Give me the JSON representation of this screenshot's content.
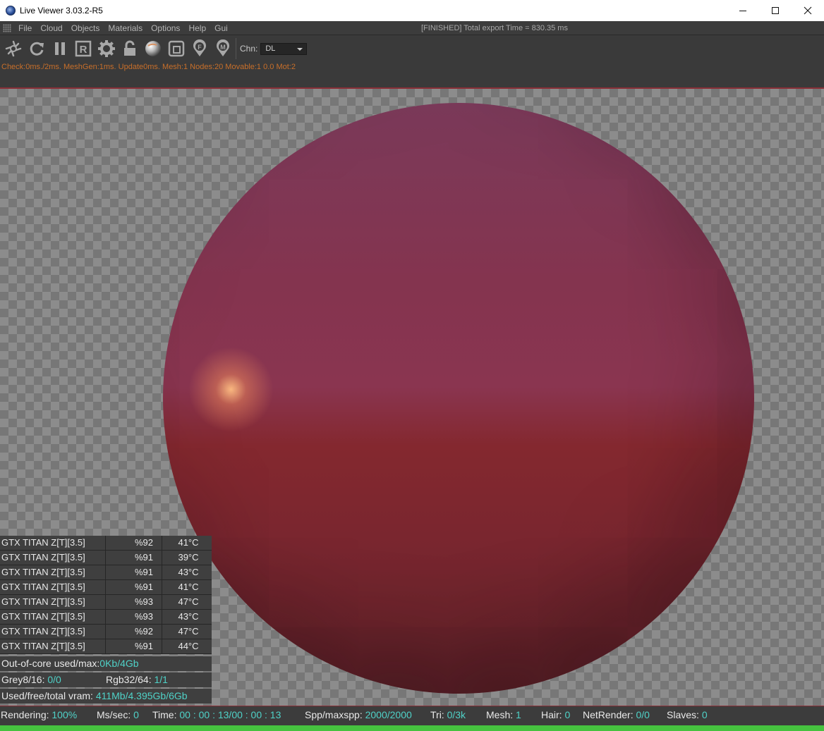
{
  "window": {
    "title": "Live Viewer 3.03.2-R5",
    "controls": {
      "minimize": "minimize-icon",
      "maximize": "maximize-icon",
      "close": "close-icon"
    }
  },
  "menu": {
    "items": [
      "File",
      "Cloud",
      "Objects",
      "Materials",
      "Options",
      "Help",
      "Gui"
    ],
    "export_status": "[FINISHED] Total export Time = 830.35 ms"
  },
  "toolbar": {
    "icons": [
      "send-scene-icon",
      "refresh-icon",
      "pause-icon",
      "render-region-icon",
      "settings-gear-icon",
      "unlock-icon",
      "material-preview-icon",
      "region-icon",
      "focus-pick-icon",
      "material-pick-icon"
    ],
    "channel_label": "Chn:",
    "channel_value": "DL"
  },
  "info_line": "Check:0ms./2ms. MeshGen:1ms. Update0ms. Mesh:1 Nodes:20 Movable:1  0.0 Mot:2",
  "gpus": [
    {
      "name": "GTX TITAN Z[T][3.5]",
      "load": "%92",
      "temp": "41°C"
    },
    {
      "name": "GTX TITAN Z[T][3.5]",
      "load": "%91",
      "temp": "39°C"
    },
    {
      "name": "GTX TITAN Z[T][3.5]",
      "load": "%91",
      "temp": "43°C"
    },
    {
      "name": "GTX TITAN Z[T][3.5]",
      "load": "%91",
      "temp": "41°C"
    },
    {
      "name": "GTX TITAN Z[T][3.5]",
      "load": "%93",
      "temp": "47°C"
    },
    {
      "name": "GTX TITAN Z[T][3.5]",
      "load": "%93",
      "temp": "43°C"
    },
    {
      "name": "GTX TITAN Z[T][3.5]",
      "load": "%92",
      "temp": "47°C"
    },
    {
      "name": "GTX TITAN Z[T][3.5]",
      "load": "%91",
      "temp": "44°C"
    }
  ],
  "memory": {
    "ooc_label": "Out-of-core used/max:",
    "ooc_value": "0Kb/4Gb",
    "grey_label": "Grey8/16:",
    "grey_value": "0/0",
    "rgb_label": "Rgb32/64:",
    "rgb_value": "1/1",
    "vram_label": "Used/free/total vram:",
    "vram_value": "411Mb/4.395Gb/6Gb"
  },
  "status": {
    "rendering_label": "Rendering:",
    "rendering_value": "100%",
    "mssec_label": "Ms/sec:",
    "mssec_value": "0",
    "time_label": "Time:",
    "time_value": "00 : 00 : 13/00 : 00 : 13",
    "spp_label": "Spp/maxspp:",
    "spp_value": "2000/2000",
    "tri_label": "Tri:",
    "tri_value": "0/3k",
    "mesh_label": "Mesh:",
    "mesh_value": "1",
    "hair_label": "Hair:",
    "hair_value": "0",
    "netrender_label": "NetRender:",
    "netrender_value": "0/0",
    "slaves_label": "Slaves:",
    "slaves_value": "0",
    "progress_fraction": 1.0
  },
  "colors": {
    "value_cyan": "#4fd2c8",
    "info_orange": "#c86f2a",
    "progress_green": "#46c23f",
    "separator_red": "#8a2f37"
  }
}
